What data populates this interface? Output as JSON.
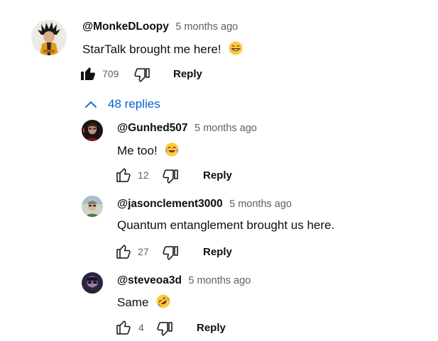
{
  "top_comment": {
    "author": "@MonkeDLoopy",
    "time": "5 months ago",
    "text": "StarTalk brought me here!",
    "emoji": "grinning-face-with-smiling-eyes",
    "likes": "709",
    "liked": true,
    "reply_label": "Reply"
  },
  "replies_toggle": {
    "label": "48 replies",
    "icon": "chevron-up-icon",
    "color": "#065fd4"
  },
  "replies": [
    {
      "author": "@Gunhed507",
      "time": "5 months ago",
      "text": "Me too!",
      "emoji": "face-with-tears-of-joy",
      "likes": "12",
      "reply_label": "Reply"
    },
    {
      "author": "@jasonclement3000",
      "time": "5 months ago",
      "text": "Quantum entanglement brought us here.",
      "likes": "27",
      "reply_label": "Reply"
    },
    {
      "author": "@steveoa3d",
      "time": "5 months ago",
      "text": "Same",
      "emoji": "rolling-on-the-floor-laughing",
      "likes": "4",
      "reply_label": "Reply"
    }
  ]
}
